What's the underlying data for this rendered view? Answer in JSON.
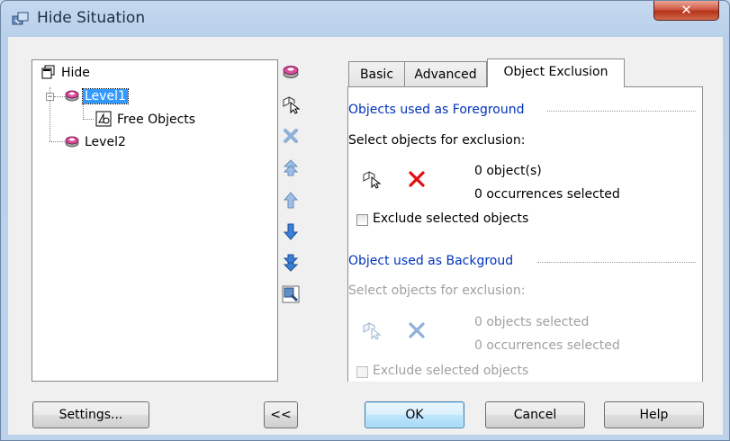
{
  "window": {
    "title": "Hide Situation",
    "close_icon": "close-icon"
  },
  "tree": {
    "items": [
      {
        "label": "Hide",
        "icon": "hide-frame-icon"
      },
      {
        "label": "Level1",
        "icon": "level-icon",
        "selected": true
      },
      {
        "label": "Free Objects",
        "icon": "free-objects-icon"
      },
      {
        "label": "Level2",
        "icon": "level-icon"
      }
    ]
  },
  "side_toolbar": {
    "buttons": [
      "add-level-icon",
      "select-objects-icon",
      "delete-icon",
      "move-top-icon",
      "move-up-icon",
      "move-down-icon",
      "move-bottom-icon",
      "zoom-icon"
    ]
  },
  "tabs": [
    {
      "label": "Basic",
      "active": false
    },
    {
      "label": "Advanced",
      "active": false
    },
    {
      "label": "Object Exclusion",
      "active": true
    }
  ],
  "foreground": {
    "title": "Objects used as Foreground",
    "select_label": "Select objects for exclusion:",
    "count_text": "0 object(s)",
    "occurrences_text": "0 occurrences selected",
    "exclude_label": "Exclude selected objects"
  },
  "background": {
    "title": "Object used as Backgroud",
    "select_label": "Select objects for exclusion:",
    "count_text": "0 objects selected",
    "occurrences_text": "0 occurrences selected",
    "exclude_label": "Exclude selected objects"
  },
  "buttons": {
    "settings": "Settings...",
    "collapse": "<<",
    "ok": "OK",
    "cancel": "Cancel",
    "help": "Help"
  },
  "colors": {
    "accent_section": "#0033bb",
    "selection": "#3399ff",
    "delete_red": "#e01010"
  }
}
